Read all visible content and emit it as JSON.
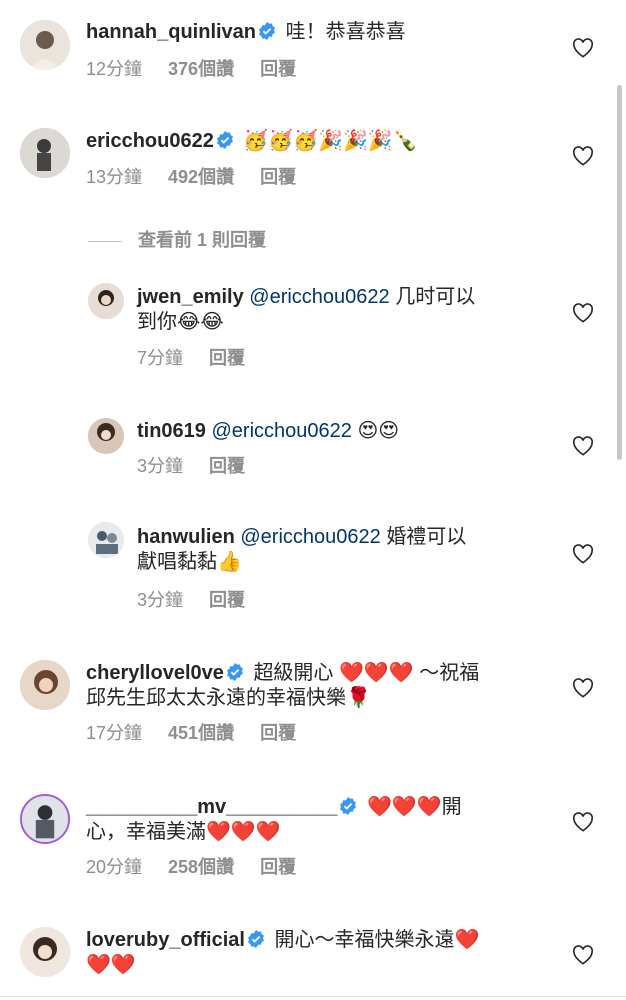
{
  "comments": [
    {
      "username": "hannah_quinlivan",
      "verified": true,
      "text": "哇！恭喜恭喜",
      "time": "12分鐘",
      "likes": "376個讚",
      "reply": "回覆"
    },
    {
      "username": "ericchou0622",
      "verified": true,
      "emoji": "🥳🥳🥳🎉🎉🎉🍾",
      "time": "13分鐘",
      "likes": "492個讚",
      "reply": "回覆",
      "view_replies": "查看前 1 則回覆"
    },
    {
      "username": "jwen_emily",
      "mention": "@ericchou0622",
      "text_line1": "几时可以",
      "text_line2": "到你",
      "emoji": "😂😂",
      "time": "7分鐘",
      "reply": "回覆"
    },
    {
      "username": "tin0619",
      "mention": "@ericchou0622",
      "emoji": "😍😍",
      "time": "3分鐘",
      "reply": "回覆"
    },
    {
      "username": "hanwulien",
      "mention": "@ericchou0622",
      "text_line1": "婚禮可以",
      "text_line2": "獻唱黏黏",
      "emoji": "👍",
      "time": "3分鐘",
      "reply": "回覆"
    },
    {
      "username": "cheryllovel0ve",
      "verified": true,
      "text_line1": "超級開心",
      "hearts1": "❤️❤️❤️",
      "text_line1b": "～祝福",
      "text_line2": "邱先生邱太太永遠的幸福快樂",
      "emoji": "🌹",
      "time": "17分鐘",
      "likes": "451個讚",
      "reply": "回覆"
    },
    {
      "username": "__________mv__________",
      "verified": true,
      "hearts1": "❤️❤️❤️",
      "text_line1b": "開",
      "text_line2": "心，幸福美滿",
      "hearts2": "❤️❤️❤️",
      "time": "20分鐘",
      "likes": "258個讚",
      "reply": "回覆"
    },
    {
      "username": "loveruby_official",
      "verified": true,
      "text_line1": "開心～幸福快樂永遠",
      "hearts1": "❤️",
      "hearts2": "❤️❤️"
    }
  ]
}
